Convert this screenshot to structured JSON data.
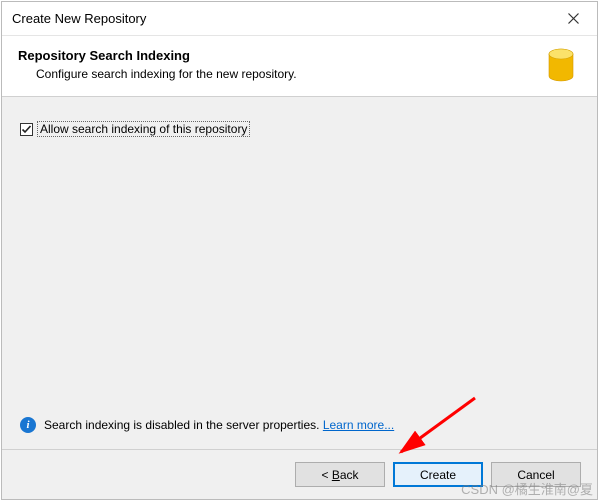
{
  "window": {
    "title": "Create New Repository"
  },
  "header": {
    "title": "Repository Search Indexing",
    "description": "Configure search indexing for the new repository."
  },
  "content": {
    "checkbox_label": "Allow search indexing of this repository",
    "checkbox_checked": "true"
  },
  "info": {
    "text": "Search indexing is disabled in the server properties. ",
    "link_text": "Learn more..."
  },
  "buttons": {
    "back_prefix": "< ",
    "back_underline": "B",
    "back_suffix": "ack",
    "create": "Create",
    "cancel": "Cancel"
  },
  "watermark": "CSDN @橘生淮南@夏"
}
